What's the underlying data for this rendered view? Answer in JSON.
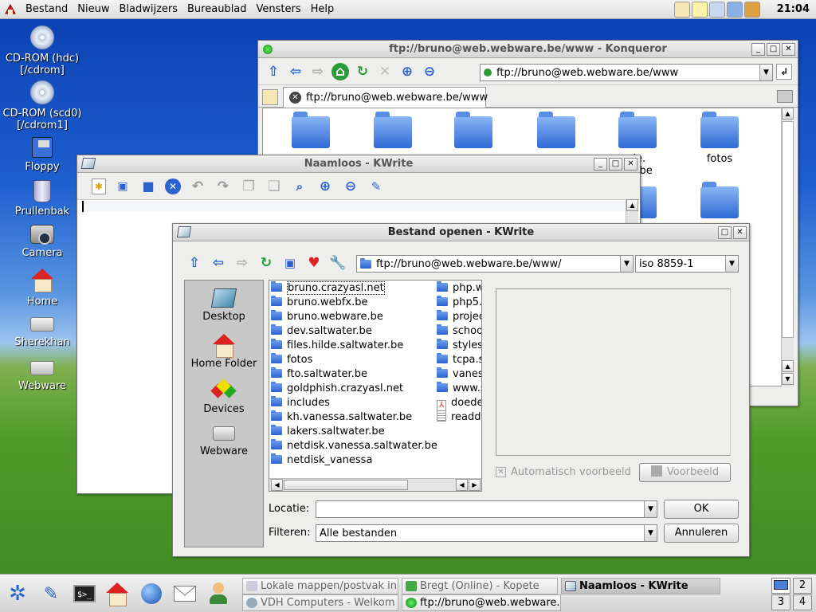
{
  "topbar": {
    "menus": [
      "Bestand",
      "Nieuw",
      "Bladwijzers",
      "Bureaublad",
      "Vensters",
      "Help"
    ],
    "clock": "21:04"
  },
  "desktop_icons": [
    {
      "label1": "CD-ROM (hdc)",
      "label2": "[/cdrom]",
      "icon": "cdrom-icon"
    },
    {
      "label1": "CD-ROM (scd0)",
      "label2": "[/cdrom1]",
      "icon": "cdrom-icon"
    },
    {
      "label1": "Floppy",
      "label2": "",
      "icon": "floppy-icon"
    },
    {
      "label1": "Prullenbak",
      "label2": "",
      "icon": "trash-icon"
    },
    {
      "label1": "Camera",
      "label2": "",
      "icon": "camera-icon"
    },
    {
      "label1": "Home",
      "label2": "",
      "icon": "home-icon"
    },
    {
      "label1": "Sherekhan",
      "label2": "",
      "icon": "network-drive-icon"
    },
    {
      "label1": "Webware",
      "label2": "",
      "icon": "network-drive-icon"
    }
  ],
  "konqueror": {
    "title": "ftp://bruno@web.webware.be/www - Konqueror",
    "location": "ftp://bruno@web.webware.be/www",
    "tab": "ftp://bruno@web.webware.be/www",
    "folders": [
      "",
      "",
      "",
      "",
      "de.\nter.be",
      "fotos"
    ]
  },
  "kwrite": {
    "title": "Naamloos - KWrite"
  },
  "dialog": {
    "title": "Bestand openen - KWrite",
    "path": "ftp://bruno@web.webware.be/www/",
    "encoding": "iso 8859-1",
    "places": [
      "Desktop",
      "Home Folder",
      "Devices",
      "Webware"
    ],
    "files_col1": [
      "bruno.crazyasl.net",
      "bruno.webfx.be",
      "bruno.webware.be",
      "dev.saltwater.be",
      "files.hilde.saltwater.be",
      "fotos",
      "fto.saltwater.be",
      "goldphish.crazyasl.net",
      "includes",
      "kh.vanessa.saltwater.be",
      "lakers.saltwater.be",
      "netdisk.vanessa.saltwater.be",
      "netdisk_vanessa"
    ],
    "files_col2": [
      {
        "name": "php.w",
        "type": "folder"
      },
      {
        "name": "php5.",
        "type": "folder"
      },
      {
        "name": "projec",
        "type": "folder"
      },
      {
        "name": "schoo",
        "type": "folder"
      },
      {
        "name": "styles",
        "type": "folder"
      },
      {
        "name": "tcpa.s",
        "type": "folder"
      },
      {
        "name": "vanes",
        "type": "folder"
      },
      {
        "name": "www.s",
        "type": "folder"
      },
      {
        "name": "doede",
        "type": "pdf"
      },
      {
        "name": "readd",
        "type": "text"
      }
    ],
    "auto_preview": "Automatisch voorbeeld",
    "preview_btn": "Voorbeeld",
    "location_label": "Locatie:",
    "location_value": "",
    "filter_label": "Filteren:",
    "filter_value": "Alle bestanden",
    "ok": "OK",
    "cancel": "Annuleren"
  },
  "taskbar": {
    "tasks": [
      {
        "label": "Lokale mappen/postvak in -",
        "active": false
      },
      {
        "label": "Bregt (Online) - Kopete",
        "active": false
      },
      {
        "label": "Naamloos - KWrite",
        "active": true
      },
      {
        "label": "VDH Computers - Welkom -",
        "active": false
      },
      {
        "label": "ftp://bruno@web.webware.be",
        "active": false
      }
    ],
    "pager": [
      "1",
      "2",
      "3",
      "4"
    ]
  },
  "colors": {
    "accent": "#2a63d0",
    "desktop_sky": "#1e5fd0",
    "desktop_grass": "#4e9a2a"
  }
}
